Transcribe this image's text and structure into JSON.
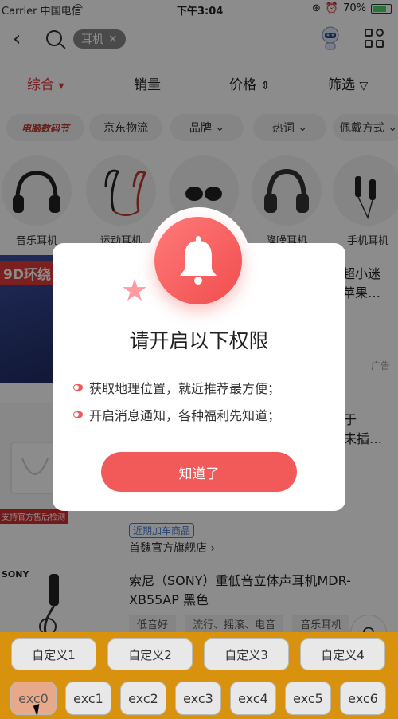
{
  "status": {
    "carrier": "Carrier 中国电信",
    "time": "下午3:04",
    "battery": "70%"
  },
  "search": {
    "chip_label": "耳机",
    "chip_close": "×"
  },
  "sort_tabs": [
    "综合",
    "销量",
    "价格",
    "筛选"
  ],
  "filter_pills": [
    "电脑数码节",
    "京东物流",
    "品牌",
    "热词",
    "佩戴方式"
  ],
  "categories": [
    "音乐耳机",
    "运动耳机",
    "",
    "降噪耳机",
    "手机耳机"
  ],
  "products": [
    {
      "image_label": "9D环绕",
      "title": "超小迷\n苹果…",
      "ad": "广告"
    },
    {
      "image_badge": "支持官方售后检测",
      "title": "于\n未插…",
      "tag": "近期加车商品",
      "shop": "首魏官方旗舰店"
    },
    {
      "title": "索尼（SONY）重低音立体声耳机MDR-XB55AP 黑色",
      "tags": [
        "低音好",
        "流行、摇滚、电音",
        "音乐耳机"
      ],
      "brand": "SONY"
    }
  ],
  "modal": {
    "title": "请开启以下权限",
    "items": [
      "获取地理位置，就近推荐最方便；",
      "开启消息通知，各种福利先知道；"
    ],
    "button": "知道了"
  },
  "keyboard": {
    "row1": [
      "自定义1",
      "自定义2",
      "自定义3",
      "自定义4"
    ],
    "row2": [
      "exc0",
      "exc1",
      "exc2",
      "exc3",
      "exc4",
      "exc5",
      "exc6"
    ]
  },
  "colors": {
    "accent": "#f25a5a",
    "keyboard_bg": "#d9920d"
  }
}
